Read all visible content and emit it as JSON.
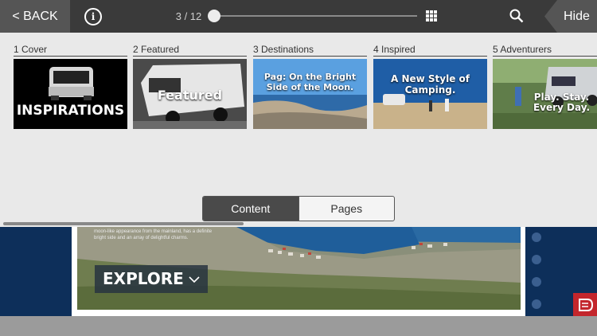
{
  "topbar": {
    "back_label": "< BACK",
    "page_counter": "3 / 12",
    "hide_label": "Hide",
    "slider_progress": 0.0,
    "icons": [
      "info-icon",
      "grid-icon",
      "search-icon"
    ]
  },
  "thumbnails": [
    {
      "label": "1 Cover",
      "title": "INSPIRATIONS"
    },
    {
      "label": "2 Featured",
      "title": "Featured"
    },
    {
      "label": "3 Destinations",
      "title": "Pag: On the Bright Side of the Moon."
    },
    {
      "label": "4 Inspired",
      "title": "A New Style of Camping."
    },
    {
      "label": "5 Adventurers",
      "title": "Play. Stay. Every Day."
    }
  ],
  "segmented": {
    "content_label": "Content",
    "pages_label": "Pages",
    "active": "Content"
  },
  "reader": {
    "photo_text": "moon-like appearance from the mainland, has a definite bright side and an array of delightful charms.",
    "explore_label": "EXPLORE"
  },
  "colors": {
    "topbar": "#3a3a3a",
    "panel": "#e9e9e9",
    "navy": "#0d2f5a",
    "brand_red": "#c3262c"
  }
}
